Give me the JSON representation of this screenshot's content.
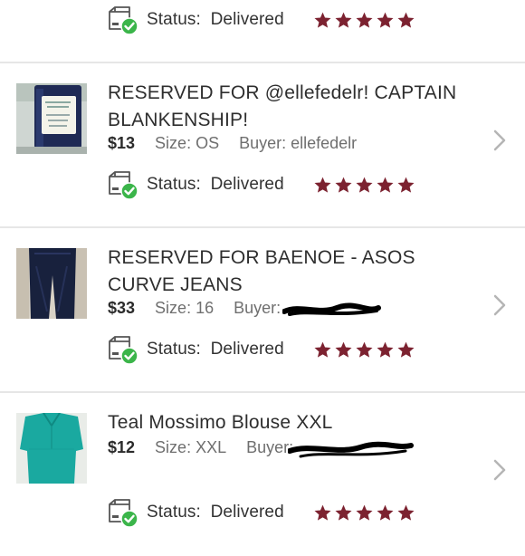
{
  "status_prefix": "Status:",
  "star_color": "#7c2230",
  "check_color": "#3bb54a",
  "top_row": {
    "status": "Delivered",
    "rating": 5
  },
  "orders": [
    {
      "title": "RESERVED FOR @ellefedelr! CAPTAIN BLANKENSHIP!",
      "price": "$13",
      "size": "Size: OS",
      "buyer": "Buyer: ellefedelr",
      "status": "Delivered",
      "rating": 5,
      "thumbnail": "navy-candle-jar"
    },
    {
      "title": "RESERVED FOR BAENOE - ASOS CURVE JEANS",
      "price": "$33",
      "size": "Size: 16",
      "buyer": "Buyer:",
      "buyer_redacted": true,
      "status": "Delivered",
      "rating": 5,
      "thumbnail": "dark-jeans"
    },
    {
      "title": "Teal Mossimo Blouse XXL",
      "price": "$12",
      "size": "Size: XXL",
      "buyer": "Buyer:",
      "buyer_redacted": true,
      "status": "Delivered",
      "rating": 5,
      "thumbnail": "teal-blouse"
    }
  ]
}
